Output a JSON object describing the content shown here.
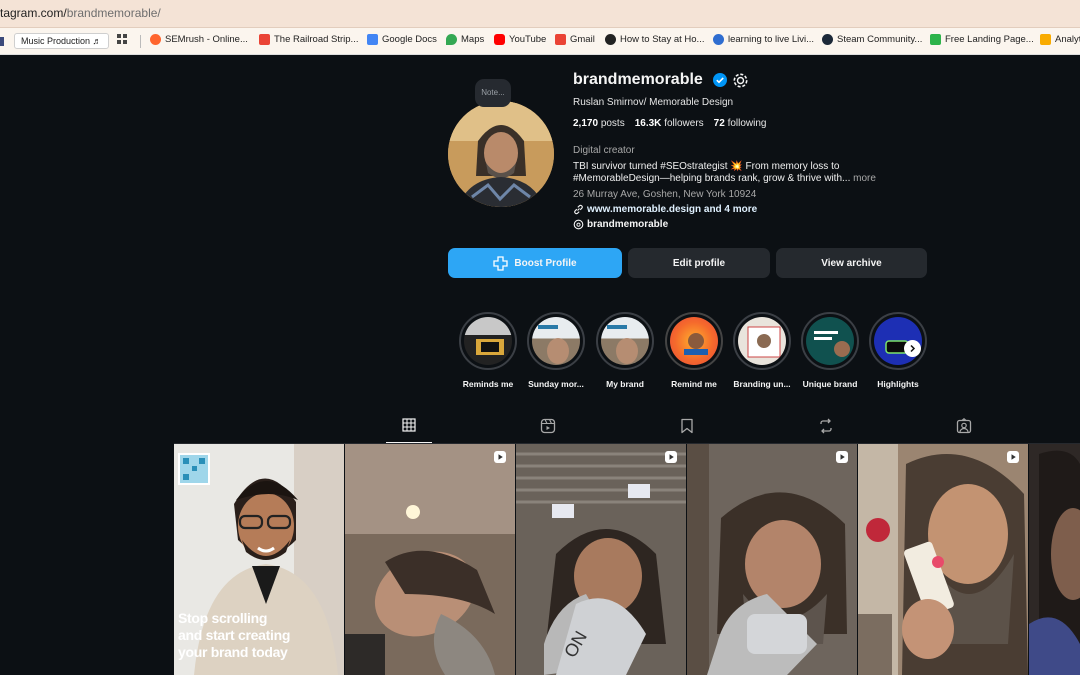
{
  "browser": {
    "url_prefix": "tagram.com/",
    "url_path": "brandmemorable/",
    "bookmarks": [
      {
        "label": "Music Production ♬"
      },
      {
        "label": "SEMrush - Online...",
        "color": "#ff642d"
      },
      {
        "label": "The Railroad Strip...",
        "color": "#ea4335"
      },
      {
        "label": "Google Docs",
        "color": "#4285f4"
      },
      {
        "label": "Maps",
        "color": "#34a853"
      },
      {
        "label": "YouTube",
        "color": "#ff0000"
      },
      {
        "label": "Gmail",
        "color": "#ea4335"
      },
      {
        "label": "How to Stay at Ho...",
        "color": "#222222"
      },
      {
        "label": "learning to live Livi...",
        "color": "#2f6dd0"
      },
      {
        "label": "Steam Community...",
        "color": "#1b2838"
      },
      {
        "label": "Free Landing Page...",
        "color": "#2db34a"
      },
      {
        "label": "Analyt",
        "color": "#f9ab00"
      }
    ]
  },
  "profile": {
    "note": "Note...",
    "username": "brandmemorable",
    "full_name": "Ruslan Smirnov/ Memorable Design",
    "posts_count": "2,170",
    "posts_label": "posts",
    "followers_count": "16.3K",
    "followers_label": "followers",
    "following_count": "72",
    "following_label": "following",
    "category": "Digital creator",
    "bio_line1": "TBI survivor turned #SEOstrategist 💥 From memory loss to",
    "bio_line2": "#MemorableDesign—helping brands rank, grow & thrive with...",
    "bio_more": "more",
    "address": "26 Murray Ave, Goshen, New York 10924",
    "link": "www.memorable.design and 4 more",
    "threads": "brandmemorable"
  },
  "actions": {
    "boost": "Boost Profile",
    "edit": "Edit profile",
    "archive": "View archive"
  },
  "highlights": [
    {
      "label": "Reminds me"
    },
    {
      "label": "Sunday mor..."
    },
    {
      "label": "My brand"
    },
    {
      "label": "Remind me"
    },
    {
      "label": "Branding un..."
    },
    {
      "label": "Unique brand"
    },
    {
      "label": "Highlights"
    }
  ],
  "tabs": [
    {
      "name": "posts",
      "icon": "grid-icon",
      "active": true
    },
    {
      "name": "reels",
      "icon": "reels-icon"
    },
    {
      "name": "saved",
      "icon": "bookmark-icon"
    },
    {
      "name": "reposts",
      "icon": "repost-icon"
    },
    {
      "name": "tagged",
      "icon": "tagged-icon"
    }
  ],
  "posts": [
    {
      "type": "image",
      "caption_line1": "Stop scrolling",
      "caption_line2": "and start creating",
      "caption_line3": "your brand today"
    },
    {
      "type": "reel"
    },
    {
      "type": "reel"
    },
    {
      "type": "reel"
    },
    {
      "type": "reel"
    },
    {
      "type": "reel"
    }
  ],
  "colors": {
    "background": "#0c1014",
    "primary_button": "#2da6f5",
    "secondary_button": "#25292e",
    "verified": "#0095f6"
  }
}
